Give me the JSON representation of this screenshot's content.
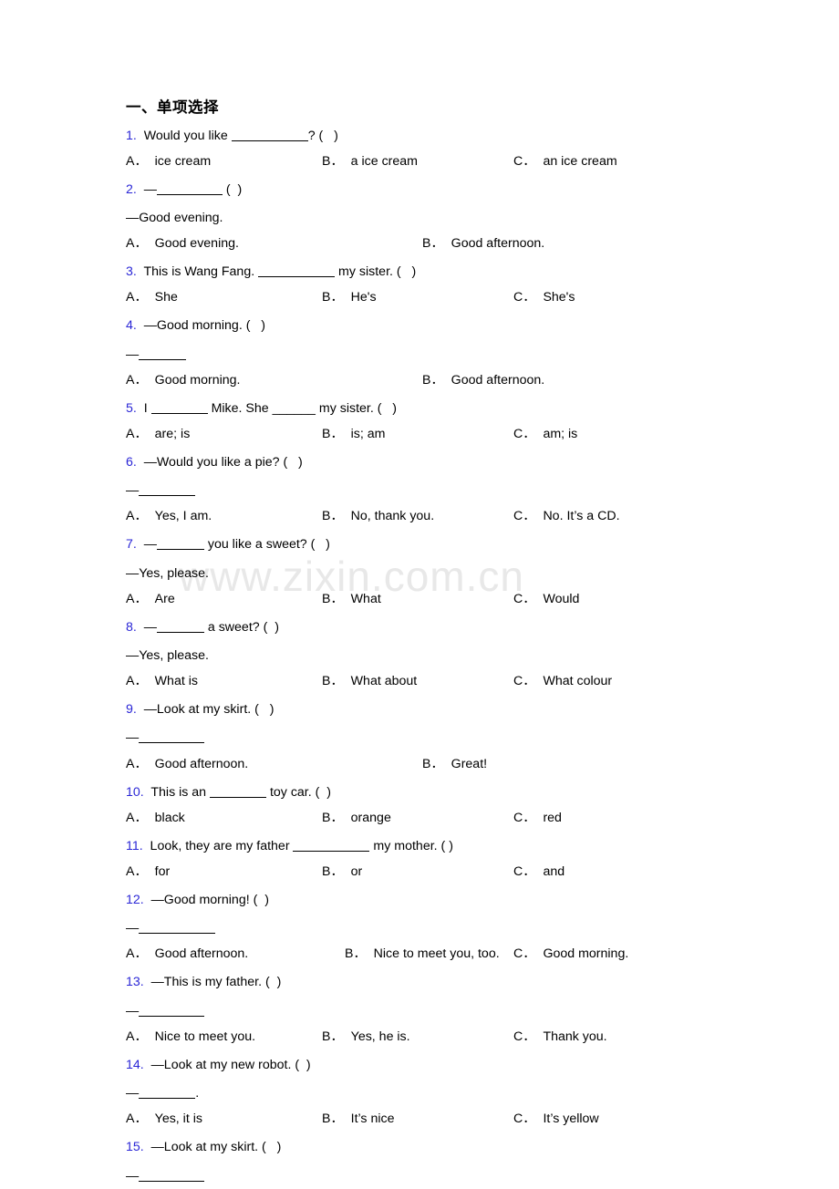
{
  "page": {
    "watermark": "www.zixin.com.cn",
    "heading": "一、单项选择",
    "number_color": "#2a26d6",
    "text_color": "#000000",
    "watermark_color": "#e8e8e8"
  },
  "questions": [
    {
      "num": "1.",
      "stem_before": "Would you like ",
      "blank": "b-xl",
      "stem_after": "? (   )",
      "continuation": null,
      "options": [
        {
          "letter": "A．",
          "text": "ice cream"
        },
        {
          "letter": "B．",
          "text": "a ice cream"
        },
        {
          "letter": "C．",
          "text": "an ice cream"
        }
      ],
      "layout": "three"
    },
    {
      "num": "2.",
      "stem_before": "—",
      "blank": "b-lg",
      "stem_after": " (  )",
      "continuation": "—Good evening.",
      "options": [
        {
          "letter": "A．",
          "text": "Good evening."
        },
        {
          "letter": "B．",
          "text": "Good afternoon."
        }
      ],
      "layout": "two"
    },
    {
      "num": "3.",
      "stem_before": "This is Wang Fang. ",
      "blank": "b-xl",
      "stem_after": " my sister. (   )",
      "continuation": null,
      "options": [
        {
          "letter": "A．",
          "text": "She"
        },
        {
          "letter": "B．",
          "text": "He's"
        },
        {
          "letter": "C．",
          "text": "She's"
        }
      ],
      "layout": "three"
    },
    {
      "num": "4.",
      "stem_before": "—Good morning. (   )",
      "blank": null,
      "stem_after": "",
      "continuation_blank": "b-sm",
      "continuation": "—",
      "options": [
        {
          "letter": "A．",
          "text": "Good morning."
        },
        {
          "letter": "B．",
          "text": "Good afternoon."
        }
      ],
      "layout": "two"
    },
    {
      "num": "5.",
      "stem_before": "I ",
      "blank": "b-md",
      "stem_after": " Mike. She ______ my sister. (   )",
      "continuation": null,
      "options": [
        {
          "letter": "A．",
          "text": "are; is"
        },
        {
          "letter": "B．",
          "text": "is; am"
        },
        {
          "letter": "C．",
          "text": "am; is"
        }
      ],
      "layout": "three"
    },
    {
      "num": "6.",
      "stem_before": "—Would you like a pie? (   )",
      "blank": null,
      "stem_after": "",
      "continuation_blank": "b-md",
      "continuation": "—",
      "options": [
        {
          "letter": "A．",
          "text": "Yes, I am."
        },
        {
          "letter": "B．",
          "text": "No, thank you."
        },
        {
          "letter": "C．",
          "text": "No. It’s a CD."
        }
      ],
      "layout": "three"
    },
    {
      "num": "7.",
      "stem_before": "—",
      "blank": "b-sm",
      "stem_after": " you like a sweet? (   )",
      "continuation": "—Yes, please.",
      "options": [
        {
          "letter": "A．",
          "text": "Are"
        },
        {
          "letter": "B．",
          "text": "What"
        },
        {
          "letter": "C．",
          "text": "Would"
        }
      ],
      "layout": "three"
    },
    {
      "num": "8.",
      "stem_before": "—",
      "blank": "b-sm",
      "stem_after": " a sweet? (  )",
      "continuation": "—Yes, please.",
      "options": [
        {
          "letter": "A．",
          "text": "What is"
        },
        {
          "letter": "B．",
          "text": "What about"
        },
        {
          "letter": "C．",
          "text": "What colour"
        }
      ],
      "layout": "three"
    },
    {
      "num": "9.",
      "stem_before": "—Look at my skirt. (   )",
      "blank": null,
      "stem_after": "",
      "continuation_blank": "b-lg",
      "continuation": "—",
      "options": [
        {
          "letter": "A．",
          "text": "Good afternoon."
        },
        {
          "letter": "B．",
          "text": "Great!"
        }
      ],
      "layout": "two"
    },
    {
      "num": "10.",
      "stem_before": "This is an ",
      "blank": "b-md",
      "stem_after": " toy car. (  )",
      "continuation": null,
      "options": [
        {
          "letter": "A．",
          "text": "black"
        },
        {
          "letter": "B．",
          "text": "orange"
        },
        {
          "letter": "C．",
          "text": "red"
        }
      ],
      "layout": "three"
    },
    {
      "num": "11.",
      "stem_before": "Look, they are my father ",
      "blank": "b-xl",
      "stem_after": " my mother. ( )",
      "continuation": null,
      "options": [
        {
          "letter": "A．",
          "text": "for"
        },
        {
          "letter": "B．",
          "text": "or"
        },
        {
          "letter": "C．",
          "text": "and"
        }
      ],
      "layout": "three"
    },
    {
      "num": "12.",
      "stem_before": "—Good morning! (  )",
      "blank": null,
      "stem_after": "",
      "continuation_blank": "b-xl",
      "continuation": "—",
      "options": [
        {
          "letter": "A．",
          "text": "Good afternoon."
        },
        {
          "letter": "B．",
          "text": "Nice to meet you, too."
        },
        {
          "letter": "C．",
          "text": "Good morning."
        }
      ],
      "layout": "wide"
    },
    {
      "num": "13.",
      "stem_before": "—This is my father. (  )",
      "blank": null,
      "stem_after": "",
      "continuation_blank": "b-lg",
      "continuation": "—",
      "options": [
        {
          "letter": "A．",
          "text": "Nice to meet you."
        },
        {
          "letter": "B．",
          "text": "Yes, he is."
        },
        {
          "letter": "C．",
          "text": "Thank you."
        }
      ],
      "layout": "three"
    },
    {
      "num": "14.",
      "stem_before": "—Look at my new robot. (  )",
      "blank": null,
      "stem_after": "",
      "continuation_blank": "b-md",
      "continuation": "—",
      "continuation_tail": ".",
      "options": [
        {
          "letter": "A．",
          "text": "Yes, it is"
        },
        {
          "letter": "B．",
          "text": "It’s nice"
        },
        {
          "letter": "C．",
          "text": "It’s yellow"
        }
      ],
      "layout": "three"
    },
    {
      "num": "15.",
      "stem_before": "—Look at my skirt. (   )",
      "blank": null,
      "stem_after": "",
      "continuation_blank": "b-lg",
      "continuation": "—",
      "options": [],
      "layout": "none"
    }
  ]
}
